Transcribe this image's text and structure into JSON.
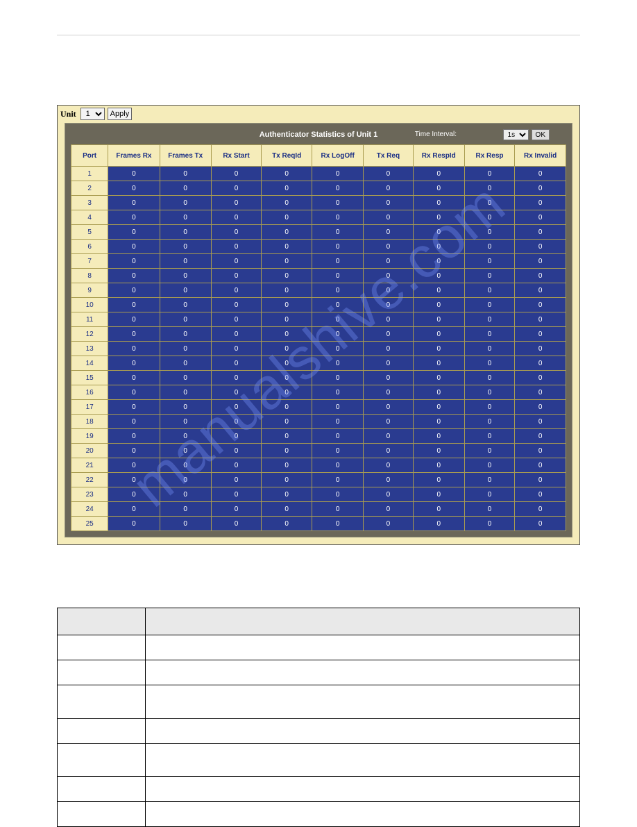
{
  "toolbar": {
    "unit_label": "Unit",
    "unit_value": "1",
    "apply_label": "Apply"
  },
  "panel": {
    "title": "Authenticator Statistics of Unit 1",
    "time_interval_label": "Time Interval:",
    "time_interval_value": "1s",
    "ok_label": "OK"
  },
  "watermark": "manualshive.com",
  "columns": [
    "Port",
    "Frames Rx",
    "Frames Tx",
    "Rx Start",
    "Tx ReqId",
    "Rx LogOff",
    "Tx Req",
    "Rx RespId",
    "Rx Resp",
    "Rx Invalid"
  ],
  "rows": [
    {
      "port": "1",
      "v": [
        "0",
        "0",
        "0",
        "0",
        "0",
        "0",
        "0",
        "0",
        "0"
      ]
    },
    {
      "port": "2",
      "v": [
        "0",
        "0",
        "0",
        "0",
        "0",
        "0",
        "0",
        "0",
        "0"
      ]
    },
    {
      "port": "3",
      "v": [
        "0",
        "0",
        "0",
        "0",
        "0",
        "0",
        "0",
        "0",
        "0"
      ]
    },
    {
      "port": "4",
      "v": [
        "0",
        "0",
        "0",
        "0",
        "0",
        "0",
        "0",
        "0",
        "0"
      ]
    },
    {
      "port": "5",
      "v": [
        "0",
        "0",
        "0",
        "0",
        "0",
        "0",
        "0",
        "0",
        "0"
      ]
    },
    {
      "port": "6",
      "v": [
        "0",
        "0",
        "0",
        "0",
        "0",
        "0",
        "0",
        "0",
        "0"
      ]
    },
    {
      "port": "7",
      "v": [
        "0",
        "0",
        "0",
        "0",
        "0",
        "0",
        "0",
        "0",
        "0"
      ]
    },
    {
      "port": "8",
      "v": [
        "0",
        "0",
        "0",
        "0",
        "0",
        "0",
        "0",
        "0",
        "0"
      ]
    },
    {
      "port": "9",
      "v": [
        "0",
        "0",
        "0",
        "0",
        "0",
        "0",
        "0",
        "0",
        "0"
      ]
    },
    {
      "port": "10",
      "v": [
        "0",
        "0",
        "0",
        "0",
        "0",
        "0",
        "0",
        "0",
        "0"
      ]
    },
    {
      "port": "11",
      "v": [
        "0",
        "0",
        "0",
        "0",
        "0",
        "0",
        "0",
        "0",
        "0"
      ]
    },
    {
      "port": "12",
      "v": [
        "0",
        "0",
        "0",
        "0",
        "0",
        "0",
        "0",
        "0",
        "0"
      ]
    },
    {
      "port": "13",
      "v": [
        "0",
        "0",
        "0",
        "0",
        "0",
        "0",
        "0",
        "0",
        "0"
      ]
    },
    {
      "port": "14",
      "v": [
        "0",
        "0",
        "0",
        "0",
        "0",
        "0",
        "0",
        "0",
        "0"
      ]
    },
    {
      "port": "15",
      "v": [
        "0",
        "0",
        "0",
        "0",
        "0",
        "0",
        "0",
        "0",
        "0"
      ]
    },
    {
      "port": "16",
      "v": [
        "0",
        "0",
        "0",
        "0",
        "0",
        "0",
        "0",
        "0",
        "0"
      ]
    },
    {
      "port": "17",
      "v": [
        "0",
        "0",
        "0",
        "0",
        "0",
        "0",
        "0",
        "0",
        "0"
      ]
    },
    {
      "port": "18",
      "v": [
        "0",
        "0",
        "0",
        "0",
        "0",
        "0",
        "0",
        "0",
        "0"
      ]
    },
    {
      "port": "19",
      "v": [
        "0",
        "0",
        "0",
        "0",
        "0",
        "0",
        "0",
        "0",
        "0"
      ]
    },
    {
      "port": "20",
      "v": [
        "0",
        "0",
        "0",
        "0",
        "0",
        "0",
        "0",
        "0",
        "0"
      ]
    },
    {
      "port": "21",
      "v": [
        "0",
        "0",
        "0",
        "0",
        "0",
        "0",
        "0",
        "0",
        "0"
      ]
    },
    {
      "port": "22",
      "v": [
        "0",
        "0",
        "0",
        "0",
        "0",
        "0",
        "0",
        "0",
        "0"
      ]
    },
    {
      "port": "23",
      "v": [
        "0",
        "0",
        "0",
        "0",
        "0",
        "0",
        "0",
        "0",
        "0"
      ]
    },
    {
      "port": "24",
      "v": [
        "0",
        "0",
        "0",
        "0",
        "0",
        "0",
        "0",
        "0",
        "0"
      ]
    },
    {
      "port": "25",
      "v": [
        "0",
        "0",
        "0",
        "0",
        "0",
        "0",
        "0",
        "0",
        "0"
      ]
    }
  ],
  "info_header_left": "",
  "info_header_right": "",
  "info_rows": [
    {
      "param": "",
      "desc": ""
    },
    {
      "param": "",
      "desc": ""
    },
    {
      "param": "",
      "desc": "",
      "tall": true
    },
    {
      "param": "",
      "desc": ""
    },
    {
      "param": "",
      "desc": "",
      "tall": true
    },
    {
      "param": "",
      "desc": ""
    },
    {
      "param": "",
      "desc": ""
    }
  ]
}
